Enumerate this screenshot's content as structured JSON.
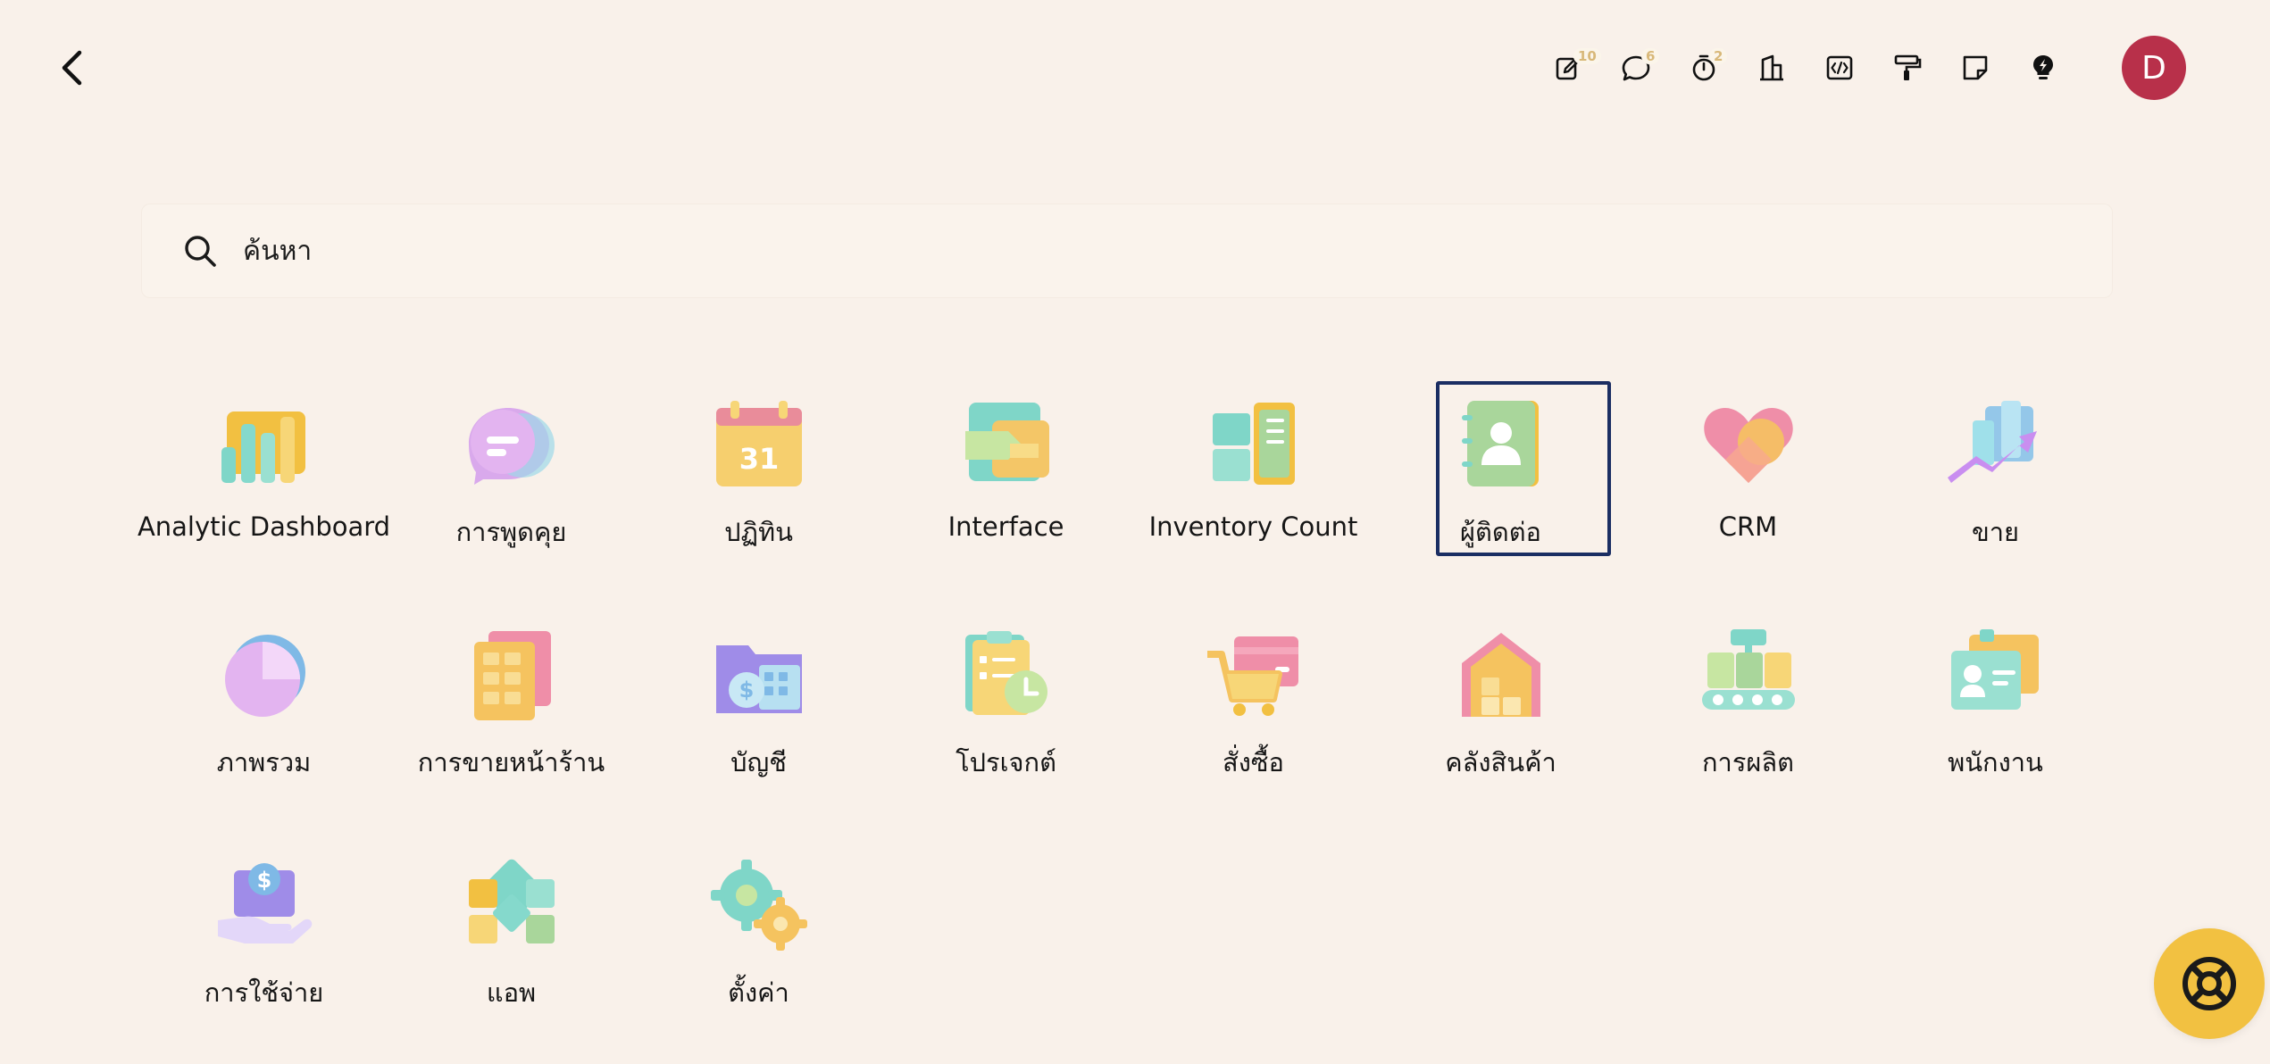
{
  "colors": {
    "background": "#f9f1ea",
    "avatar": "#b8304a",
    "selection": "#1b2e63",
    "help": "#f2c141",
    "badge": "#d8b879"
  },
  "systray": [
    {
      "icon": "edit-note-icon",
      "badge": "10"
    },
    {
      "icon": "chat-bubble-icon",
      "badge": "6"
    },
    {
      "icon": "stopwatch-icon",
      "badge": "2"
    },
    {
      "icon": "building-icon",
      "badge": ""
    },
    {
      "icon": "code-icon",
      "badge": ""
    },
    {
      "icon": "paint-roller-icon",
      "badge": ""
    },
    {
      "icon": "sticky-note-icon",
      "badge": ""
    },
    {
      "icon": "lightbulb-icon",
      "badge": ""
    }
  ],
  "user": {
    "initial": "D"
  },
  "search": {
    "placeholder": "ค้นหา"
  },
  "apps": [
    {
      "label": "Analytic Dashboard",
      "icon": "analytic-dashboard-icon"
    },
    {
      "label": "การพูดคุย",
      "icon": "discuss-icon"
    },
    {
      "label": "ปฏิทิน",
      "icon": "calendar-icon",
      "icon_text": "31"
    },
    {
      "label": "Interface",
      "icon": "interface-icon"
    },
    {
      "label": "Inventory Count",
      "icon": "inventory-count-icon"
    },
    {
      "label": "ผู้ติดต่อ",
      "icon": "contacts-icon",
      "selected": true
    },
    {
      "label": "CRM",
      "icon": "crm-icon"
    },
    {
      "label": "ขาย",
      "icon": "sales-icon"
    },
    {
      "label": "ภาพรวม",
      "icon": "overview-icon"
    },
    {
      "label": "การขายหน้าร้าน",
      "icon": "point-of-sale-icon"
    },
    {
      "label": "บัญชี",
      "icon": "accounting-icon"
    },
    {
      "label": "โปรเจกต์",
      "icon": "project-icon"
    },
    {
      "label": "สั่งซื้อ",
      "icon": "purchase-icon"
    },
    {
      "label": "คลังสินค้า",
      "icon": "inventory-icon"
    },
    {
      "label": "การผลิต",
      "icon": "manufacturing-icon"
    },
    {
      "label": "พนักงาน",
      "icon": "employees-icon"
    },
    {
      "label": "การใช้จ่าย",
      "icon": "expenses-icon"
    },
    {
      "label": "แอพ",
      "icon": "apps-icon"
    },
    {
      "label": "ตั้งค่า",
      "icon": "settings-icon"
    }
  ]
}
